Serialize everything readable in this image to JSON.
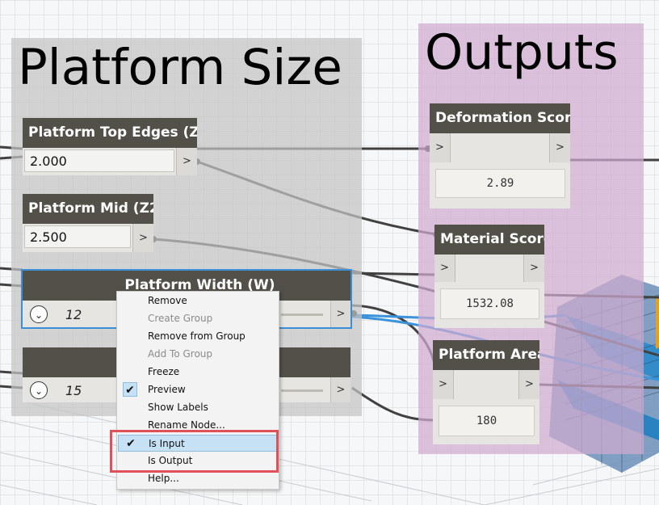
{
  "groups": {
    "platform_size": {
      "title": "Platform Size"
    },
    "outputs": {
      "title": "Outputs"
    }
  },
  "nodes": {
    "top_edges": {
      "title": "Platform Top Edges (Z1)",
      "value": "2.000",
      "port": ">"
    },
    "mid": {
      "title": "Platform Mid (Z2)",
      "value": "2.500",
      "port": ">"
    },
    "width": {
      "title": "Platform Width (W)",
      "value": "12",
      "port": ">"
    },
    "length": {
      "title": "",
      "value": "15",
      "port": ">"
    },
    "deformation": {
      "title": "Deformation Score",
      "in_port": ">",
      "out_port": ">",
      "value": "2.89"
    },
    "material": {
      "title": "Material Score",
      "in_port": ">",
      "out_port": ">",
      "value": "1532.08"
    },
    "area": {
      "title": "Platform Area",
      "in_port": ">",
      "out_port": ">",
      "value": "180"
    }
  },
  "context_menu": {
    "items": [
      {
        "label": "Remove",
        "enabled": true,
        "checked": false
      },
      {
        "label": "Create Group",
        "enabled": false,
        "checked": false
      },
      {
        "label": "Remove from Group",
        "enabled": true,
        "checked": false
      },
      {
        "label": "Add To Group",
        "enabled": false,
        "checked": false
      },
      {
        "label": "Freeze",
        "enabled": true,
        "checked": false
      },
      {
        "label": "Preview",
        "enabled": true,
        "checked": true
      },
      {
        "label": "Show Labels",
        "enabled": true,
        "checked": false
      },
      {
        "label": "Rename Node...",
        "enabled": true,
        "checked": false
      },
      {
        "label": "Is Input",
        "enabled": true,
        "checked": true,
        "highlighted": true
      },
      {
        "label": "Is Output",
        "enabled": true,
        "checked": false
      },
      {
        "label": "Help...",
        "enabled": true,
        "checked": false
      }
    ],
    "check_glyph": "✔"
  },
  "colors": {
    "node_header": "#535049",
    "selection": "#3b8fd6",
    "highlight_box": "#e05059",
    "platform_group": "#c4c4c4",
    "outputs_group": "#ceaad0"
  },
  "icons": {
    "dropdown": "chevron-down-icon",
    "check": "check-icon"
  }
}
